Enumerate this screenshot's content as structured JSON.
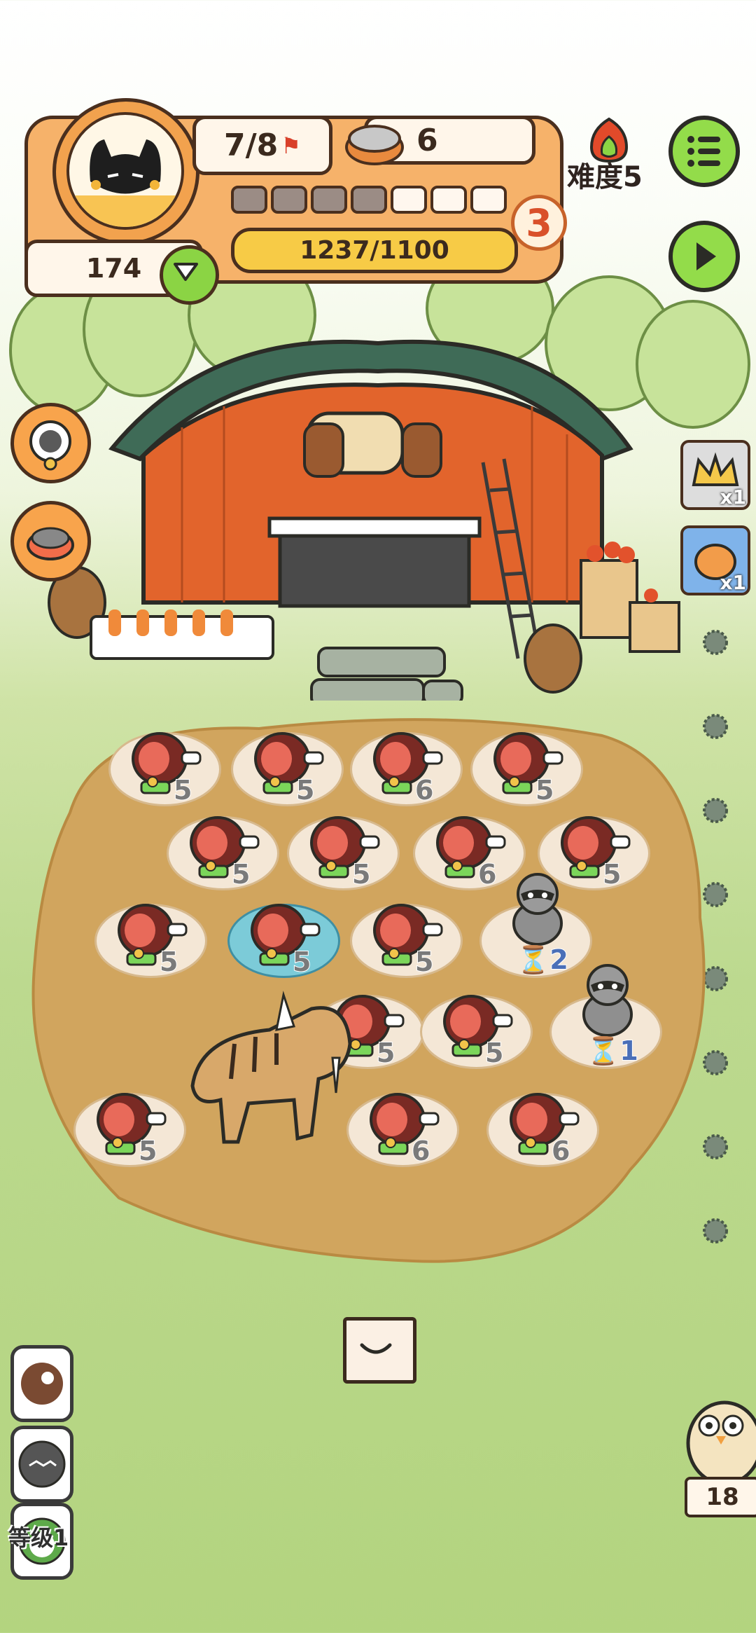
{
  "hud": {
    "flags": "7/8",
    "food_count": "6",
    "coins": "174",
    "level_number": "3",
    "xp": "1237/1100",
    "segments_total": 7,
    "segments_filled": 4,
    "difficulty_label": "难度5"
  },
  "inventory": {
    "crown_count": "x1",
    "bag_count": "x1"
  },
  "field": {
    "plots": [
      {
        "type": "meat",
        "value": "5"
      },
      {
        "type": "meat",
        "value": "5"
      },
      {
        "type": "meat",
        "value": "6"
      },
      {
        "type": "meat",
        "value": "5"
      },
      {
        "type": "meat",
        "value": "5"
      },
      {
        "type": "meat",
        "value": "5"
      },
      {
        "type": "meat",
        "value": "6"
      },
      {
        "type": "meat",
        "value": "5"
      },
      {
        "type": "meat",
        "value": "5"
      },
      {
        "type": "meat-water",
        "value": "5"
      },
      {
        "type": "meat",
        "value": "5"
      },
      {
        "type": "raccoon",
        "value": "2"
      },
      {
        "type": "meat",
        "value": "5"
      },
      {
        "type": "meat",
        "value": "5"
      },
      {
        "type": "raccoon",
        "value": "1"
      },
      {
        "type": "meat",
        "value": "5"
      },
      {
        "type": "meat",
        "value": "6"
      },
      {
        "type": "meat",
        "value": "6"
      }
    ]
  },
  "bottom": {
    "level_label": "等级1",
    "owl_count": "18"
  },
  "colors": {
    "accent_orange": "#f6b26a",
    "button_green": "#93dc4a",
    "xp_yellow": "#f7cb46",
    "outline": "#4a2f1e"
  }
}
